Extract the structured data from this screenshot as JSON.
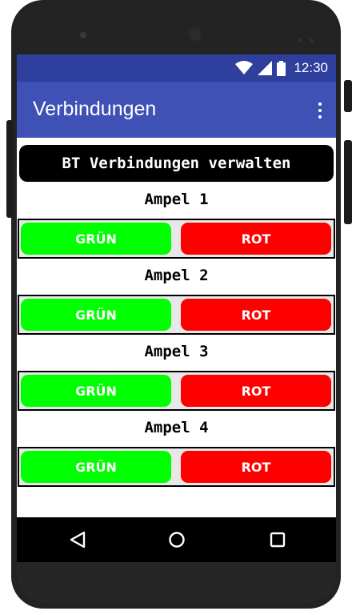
{
  "status_bar": {
    "time": "12:30",
    "icons": [
      "wifi-icon",
      "signal-icon",
      "battery-icon"
    ]
  },
  "app_bar": {
    "title": "Verbindungen",
    "menu_icon": "overflow-menu-icon"
  },
  "main": {
    "manage_button": "BT Verbindungen verwalten",
    "groups": [
      {
        "label": "Ampel 1",
        "green_label": "GRÜN",
        "red_label": "ROT"
      },
      {
        "label": "Ampel 2",
        "green_label": "GRÜN",
        "red_label": "ROT"
      },
      {
        "label": "Ampel 3",
        "green_label": "GRÜN",
        "red_label": "ROT"
      },
      {
        "label": "Ampel 4",
        "green_label": "GRÜN",
        "red_label": "ROT"
      }
    ]
  },
  "nav_bar": {
    "icons": [
      "back-icon",
      "home-icon",
      "recents-icon"
    ]
  },
  "colors": {
    "status_bar": "#2f3f9e",
    "app_bar": "#3f51b5",
    "green": "#00ff00",
    "red": "#ff0000",
    "black": "#000000"
  }
}
